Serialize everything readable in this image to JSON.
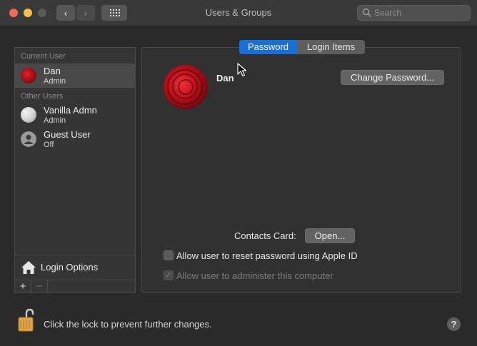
{
  "window": {
    "title": "Users & Groups"
  },
  "toolbar": {
    "back": "‹",
    "forward": "›",
    "search_placeholder": "Search"
  },
  "sidebar": {
    "current_user_header": "Current User",
    "other_users_header": "Other Users",
    "users": [
      {
        "name": "Dan",
        "role": "Admin",
        "avatar": "rose-icon",
        "selected": true
      },
      {
        "name": "Vanilla Admn",
        "role": "Admin",
        "avatar": "golf-ball-icon",
        "selected": false
      },
      {
        "name": "Guest User",
        "role": "Off",
        "avatar": "guest-user-icon",
        "selected": false
      }
    ],
    "login_options": "Login Options",
    "add": "+",
    "remove": "−"
  },
  "tabs": [
    {
      "label": "Password",
      "active": true
    },
    {
      "label": "Login Items",
      "active": false
    }
  ],
  "detail": {
    "user_name": "Dan",
    "change_password": "Change Password...",
    "contacts_card_label": "Contacts Card:",
    "open_button": "Open...",
    "allow_reset": {
      "label": "Allow user to reset password using Apple ID",
      "checked": false
    },
    "allow_admin": {
      "label": "Allow user to administer this computer",
      "checked": true,
      "enabled": false
    }
  },
  "footer": {
    "lock_text": "Click the lock to prevent further changes.",
    "help": "?"
  },
  "colors": {
    "accent": "#1b6ed6",
    "close": "#ed6a5e",
    "minimize": "#f4bf4f",
    "lock": "#e0a24a"
  }
}
